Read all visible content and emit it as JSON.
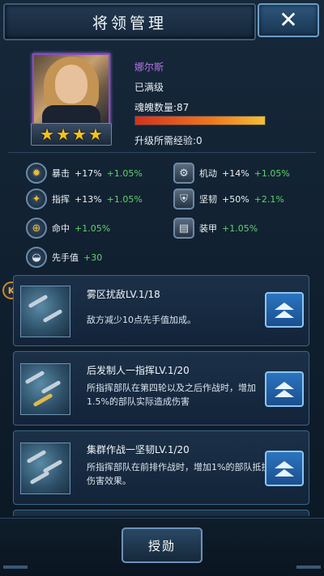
{
  "header": {
    "title": "将领管理",
    "close_icon": "close-icon"
  },
  "general": {
    "name": "娜尔斯",
    "level_status": "已满级",
    "soul_label": "魂魄数量:87",
    "soul_fill_fraction": 1.0,
    "upgrade_exp_label": "升级所需经验:0",
    "stars": 4
  },
  "attributes": [
    {
      "label": "暴击",
      "value": "+17%",
      "bonus": "+1.05%",
      "icon": "crit-burst-icon"
    },
    {
      "label": "机动",
      "value": "+14%",
      "bonus": "+1.05%",
      "icon": "gear-wheel-icon"
    },
    {
      "label": "指挥",
      "value": "+13%",
      "bonus": "+1.05%",
      "icon": "command-shield-icon"
    },
    {
      "label": "坚韧",
      "value": "+50%",
      "bonus": "+2.1%",
      "icon": "shield-icon"
    },
    {
      "label": "命中",
      "value": "",
      "bonus": "+1.05%",
      "icon": "crosshair-icon"
    },
    {
      "label": "装甲",
      "value": "",
      "bonus": "+1.05%",
      "icon": "armor-plate-icon"
    },
    {
      "label": "先手值",
      "value": "",
      "bonus": "+30",
      "icon": "officer-cap-icon"
    }
  ],
  "skills": [
    {
      "title": "雾区扰敌LV.1/18",
      "desc": "敌方减少10点先手值加成。"
    },
    {
      "title": "后发制人一指挥LV.1/20",
      "desc": "所指挥部队在第四轮以及之后作战时，增加1.5%的部队实际造成伤害"
    },
    {
      "title": "集群作战一坚韧LV.1/20",
      "desc": "所指挥部队在前排作战时，增加1%的部队抵抗伤害效果。"
    }
  ],
  "badge": {
    "letter": "K"
  },
  "footer": {
    "grant_button": "授勋"
  },
  "colors": {
    "name": "#b673e8",
    "bonus": "#5fd46b",
    "star": "#f5c21a"
  }
}
